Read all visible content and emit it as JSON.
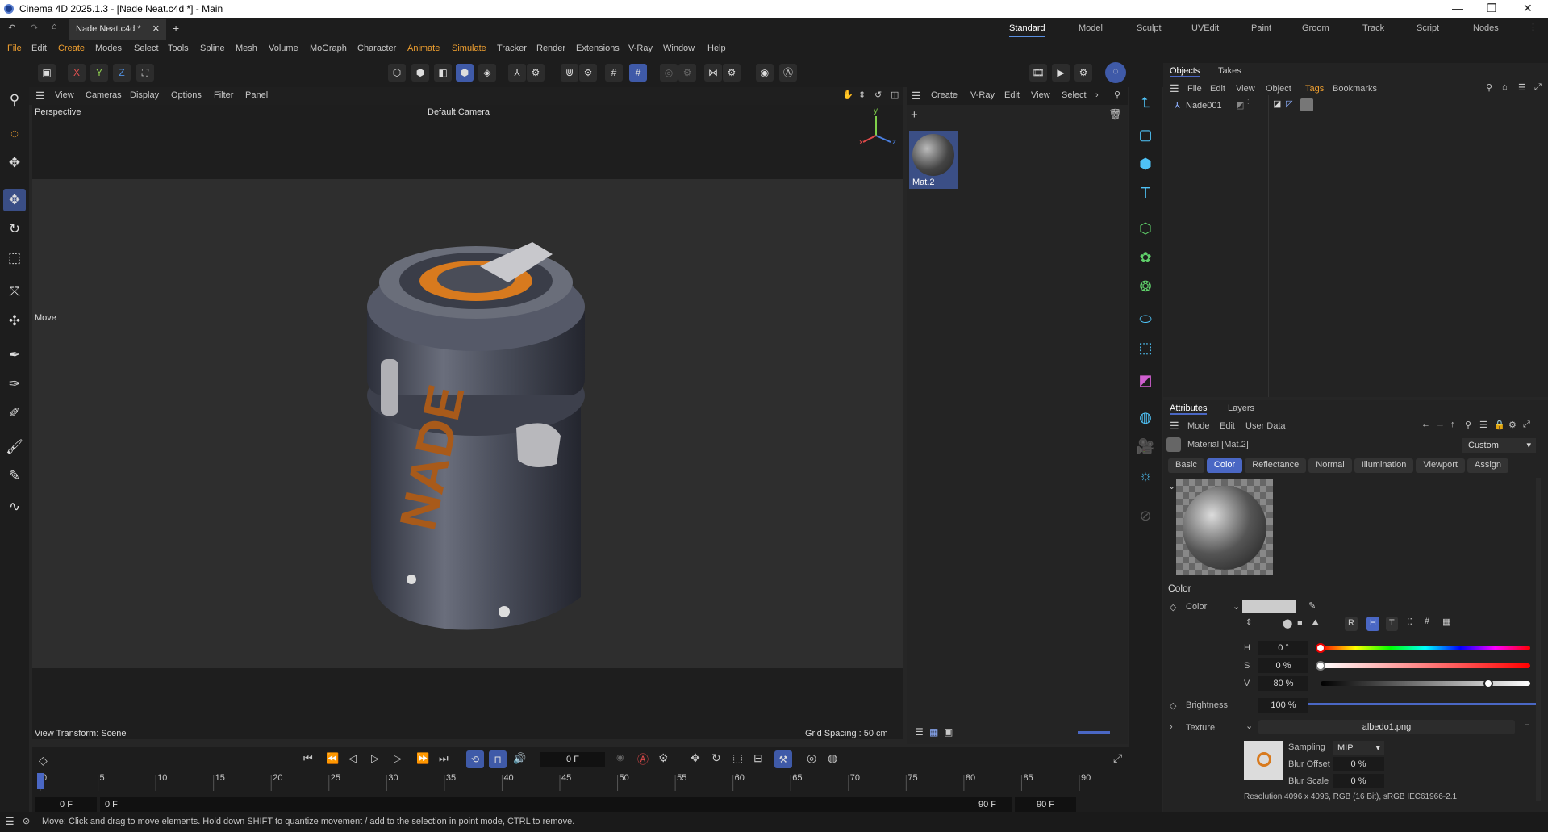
{
  "window": {
    "title": "Cinema 4D 2025.1.3 - [Nade Neat.c4d *] - Main"
  },
  "tabs": {
    "doc": "Nade Neat.c4d *"
  },
  "layouts": [
    "Standard",
    "Model",
    "Sculpt",
    "UVEdit",
    "Paint",
    "Groom",
    "Track",
    "Script",
    "Nodes"
  ],
  "menu": [
    "File",
    "Edit",
    "Create",
    "Modes",
    "Select",
    "Tools",
    "Spline",
    "Mesh",
    "Volume",
    "MoGraph",
    "Character",
    "Animate",
    "Simulate",
    "Tracker",
    "Render",
    "Extensions",
    "V-Ray",
    "Window",
    "Help"
  ],
  "axes": {
    "x": "X",
    "y": "Y",
    "z": "Z"
  },
  "viewport": {
    "menu": [
      "View",
      "Cameras",
      "Display",
      "Options",
      "Filter",
      "Panel"
    ],
    "name": "Perspective",
    "camera": "Default Camera",
    "tool": "Move",
    "transform": "View Transform: Scene",
    "grid": "Grid Spacing : 50 cm",
    "axis_x": "x",
    "axis_y": "y",
    "axis_z": "z",
    "label_text": "NADE"
  },
  "material_manager": {
    "menu": [
      "Create",
      "V-Ray",
      "Edit",
      "View",
      "Select"
    ],
    "material_name": "Mat.2"
  },
  "objects": {
    "tabs": [
      "Objects",
      "Takes"
    ],
    "menu": [
      "File",
      "Edit",
      "View",
      "Object",
      "Tags",
      "Bookmarks"
    ],
    "item": "Nade001"
  },
  "attributes": {
    "tabs": [
      "Attributes",
      "Layers"
    ],
    "menu": [
      "Mode",
      "Edit",
      "User Data"
    ],
    "title": "Material [Mat.2]",
    "preset": "Custom",
    "channel_tabs": [
      "Basic",
      "Color",
      "Reflectance",
      "Normal",
      "Illumination",
      "Viewport",
      "Assign"
    ],
    "section": "Color",
    "color_label": "Color",
    "h_label": "H",
    "h_value": "0 °",
    "s_label": "S",
    "s_value": "0 %",
    "v_label": "V",
    "v_value": "80 %",
    "brightness_label": "Brightness",
    "brightness_value": "100 %",
    "texture_label": "Texture",
    "texture_file": "albedo1.png",
    "sampling_label": "Sampling",
    "sampling_value": "MIP",
    "blur_offset_label": "Blur Offset",
    "blur_offset_value": "0 %",
    "blur_scale_label": "Blur Scale",
    "blur_scale_value": "0 %",
    "resolution": "Resolution 4096 x 4096, RGB (16 Bit), sRGB IEC61966-2.1",
    "mode_buttons": [
      "R",
      "H",
      "T"
    ],
    "hsv": {
      "h": 0,
      "s": 0,
      "v": 0.8
    },
    "brightness": 1.0
  },
  "timeline": {
    "current_frame": "0 F",
    "start": "0 F",
    "start2": "0 F",
    "end": "90 F",
    "end2": "90 F",
    "ticks": [
      "0",
      "5",
      "10",
      "15",
      "20",
      "25",
      "30",
      "35",
      "40",
      "45",
      "50",
      "55",
      "60",
      "65",
      "70",
      "75",
      "80",
      "85",
      "90"
    ]
  },
  "status": {
    "message": "Move: Click and drag to move elements. Hold down SHIFT to quantize movement / add to the selection in point mode, CTRL to remove."
  },
  "colors": {
    "accent": "#4a67c4",
    "icon_blue": "#4fc3f7",
    "orange": "#d87a1e"
  }
}
